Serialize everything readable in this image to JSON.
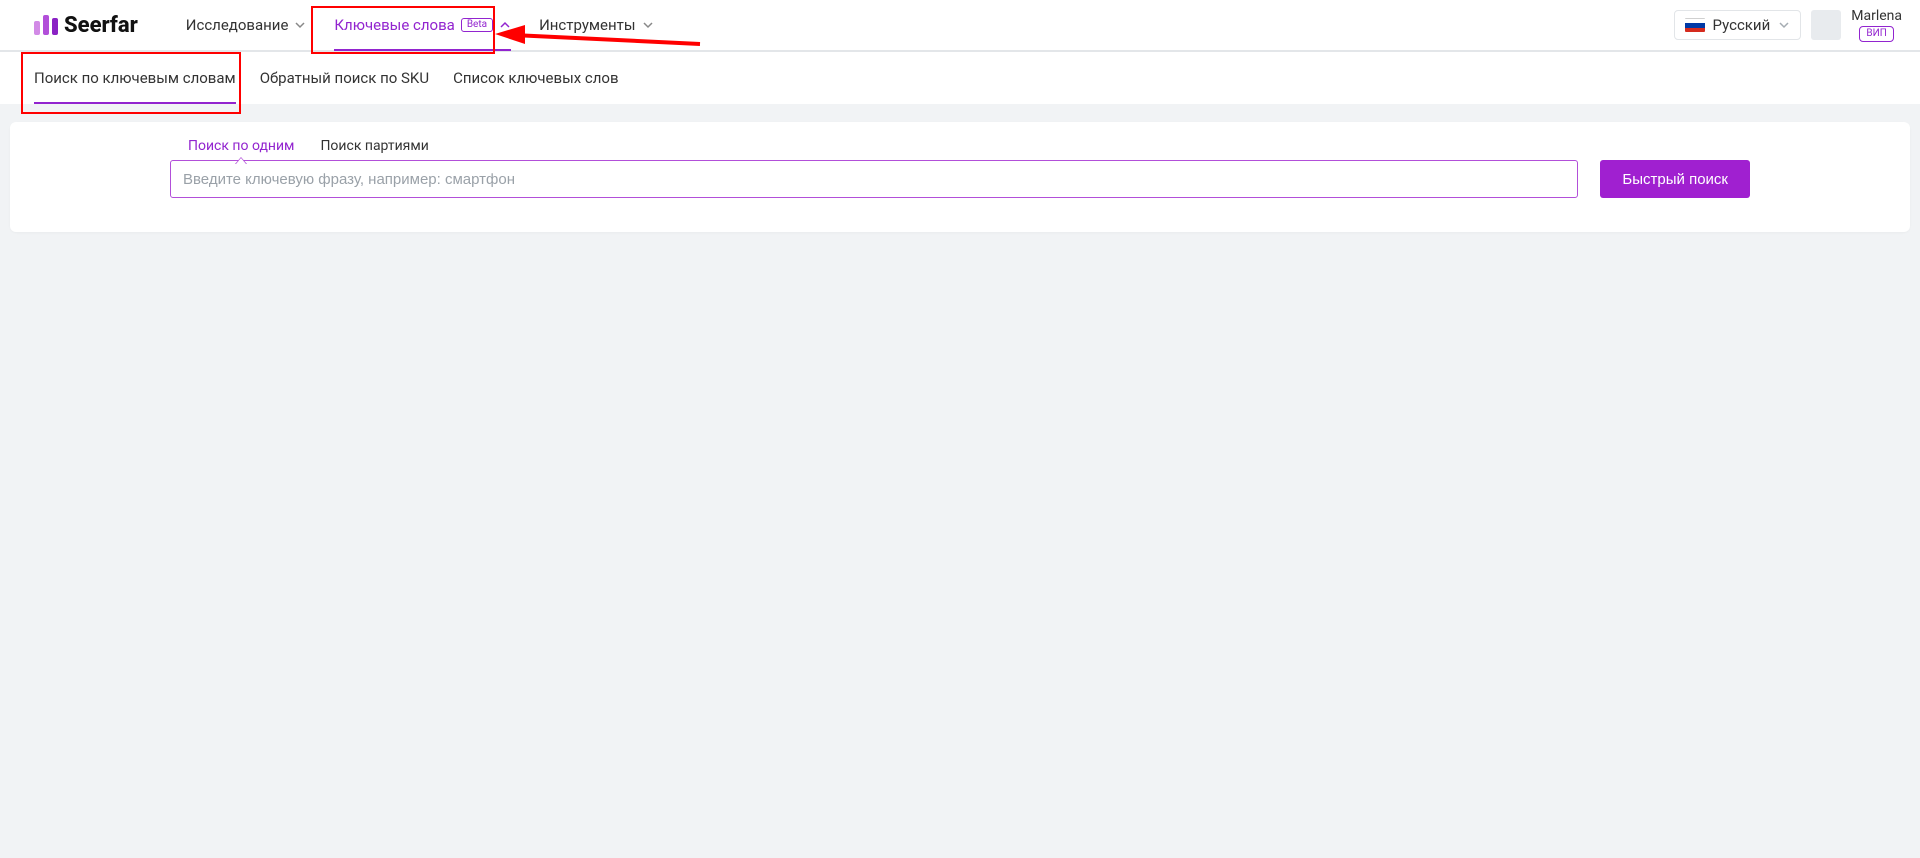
{
  "brand": {
    "name": "Seerfar"
  },
  "top_nav": {
    "items": [
      {
        "label": "Исследование",
        "has_chevron": true,
        "chevron": "down",
        "active": false,
        "badge": null
      },
      {
        "label": "Ключевые слова",
        "has_chevron": true,
        "chevron": "up",
        "active": true,
        "badge": "Beta"
      },
      {
        "label": "Инструменты",
        "has_chevron": true,
        "chevron": "down",
        "active": false,
        "badge": null
      }
    ]
  },
  "language": {
    "label": "Русский"
  },
  "user": {
    "name": "Marlena",
    "badge": "ВИП"
  },
  "sub_nav": {
    "items": [
      {
        "label": "Поиск по ключевым словам",
        "active": true
      },
      {
        "label": "Обратный поиск по SKU",
        "active": false
      },
      {
        "label": "Список ключевых слов",
        "active": false
      }
    ]
  },
  "panel": {
    "tabs": [
      {
        "label": "Поиск по одним",
        "active": true
      },
      {
        "label": "Поиск партиями",
        "active": false
      }
    ],
    "search": {
      "placeholder": "Введите ключевую фразу, например: смартфон",
      "button_label": "Быстрый поиск"
    }
  },
  "colors": {
    "accent": "#9224cf",
    "button": "#a020d0",
    "annotation": "#ff0000"
  }
}
